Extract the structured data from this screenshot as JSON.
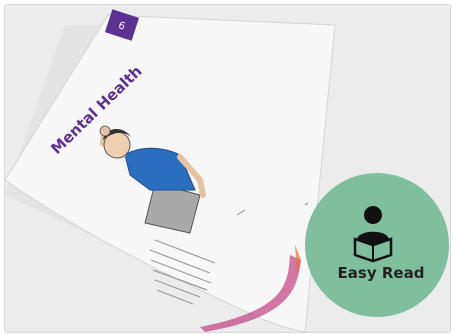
{
  "booklet": {
    "page_number": "6",
    "title": "Mental Health",
    "accent_color": "#5b3191"
  },
  "badge": {
    "label": "Easy Read",
    "circle_color": "#7fbf9e",
    "icon": "reading-person-icon"
  }
}
